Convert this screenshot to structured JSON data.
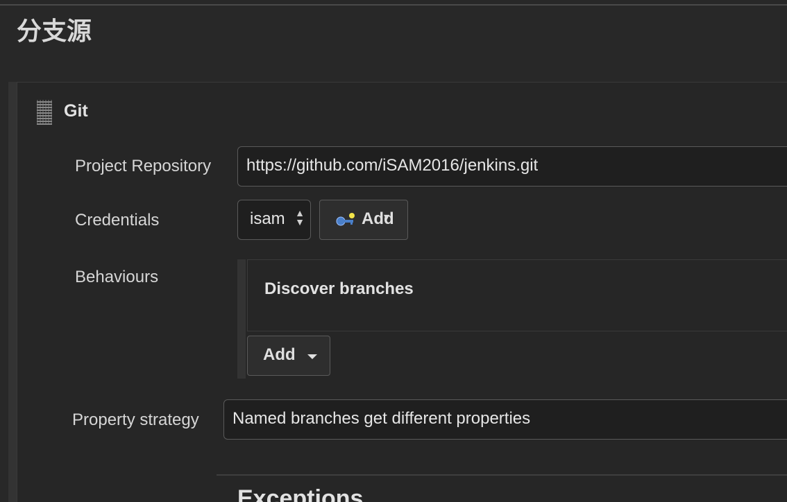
{
  "section": {
    "title": "分支源"
  },
  "source": {
    "name": "Git",
    "grip_icon": "drag-handle-icon",
    "project_repository": {
      "label": "Project Repository",
      "value": "https://github.com/iSAM2016/jenkins.git"
    },
    "credentials": {
      "label": "Credentials",
      "selected": "isam",
      "add_label": "Add",
      "add_icon": "key-icon"
    },
    "behaviours": {
      "label": "Behaviours",
      "items": [
        {
          "title": "Discover branches"
        }
      ],
      "add_label": "Add"
    },
    "property_strategy": {
      "label": "Property strategy",
      "value": "Named branches get different properties"
    }
  },
  "exceptions": {
    "heading": "Exceptions"
  }
}
